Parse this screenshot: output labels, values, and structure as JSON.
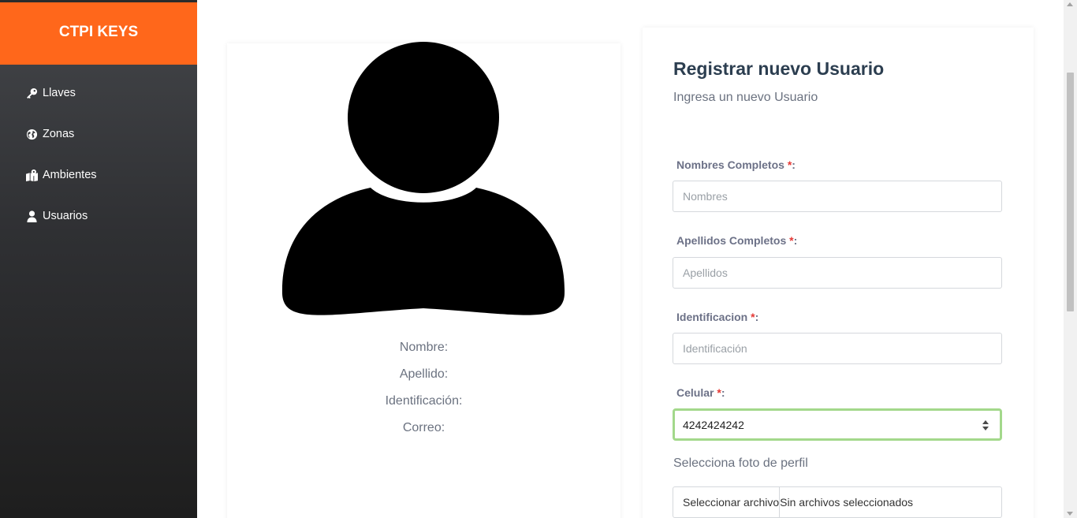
{
  "sidebar": {
    "brand": "CTPI KEYS",
    "items": [
      {
        "label": "Llaves",
        "icon": "key-icon"
      },
      {
        "label": "Zonas",
        "icon": "globe-icon"
      },
      {
        "label": "Ambientes",
        "icon": "map-marker-icon"
      },
      {
        "label": "Usuarios",
        "icon": "user-icon"
      }
    ]
  },
  "profile": {
    "avatar_icon": "user-silhouette-icon",
    "nombre_label": "Nombre:",
    "apellido_label": "Apellido:",
    "identificacion_label": "Identificación:",
    "correo_label": "Correo:"
  },
  "form": {
    "title": "Registrar nuevo Usuario",
    "subtitle": "Ingresa un nuevo Usuario",
    "nombres": {
      "label": "Nombres Completos",
      "required": "*",
      "suffix": ":",
      "placeholder": "Nombres",
      "value": ""
    },
    "apellidos": {
      "label": "Apellidos Completos",
      "required": "*",
      "suffix": ":",
      "placeholder": "Apellidos",
      "value": ""
    },
    "identificacion": {
      "label": "Identificacion",
      "required": "*",
      "suffix": ":",
      "placeholder": "Identificación",
      "value": ""
    },
    "celular": {
      "label": "Celular",
      "required": "*",
      "suffix": ":",
      "placeholder": "",
      "value": "4242424242"
    },
    "photo_label": "Selecciona foto de perfil",
    "file_button": "Seleccionar archivo",
    "file_status": "Sin archivos seleccionados"
  },
  "colors": {
    "brand": "#ff671b",
    "required": "#e53935",
    "focus_border": "#a3d88b",
    "title": "#2c3e50"
  }
}
